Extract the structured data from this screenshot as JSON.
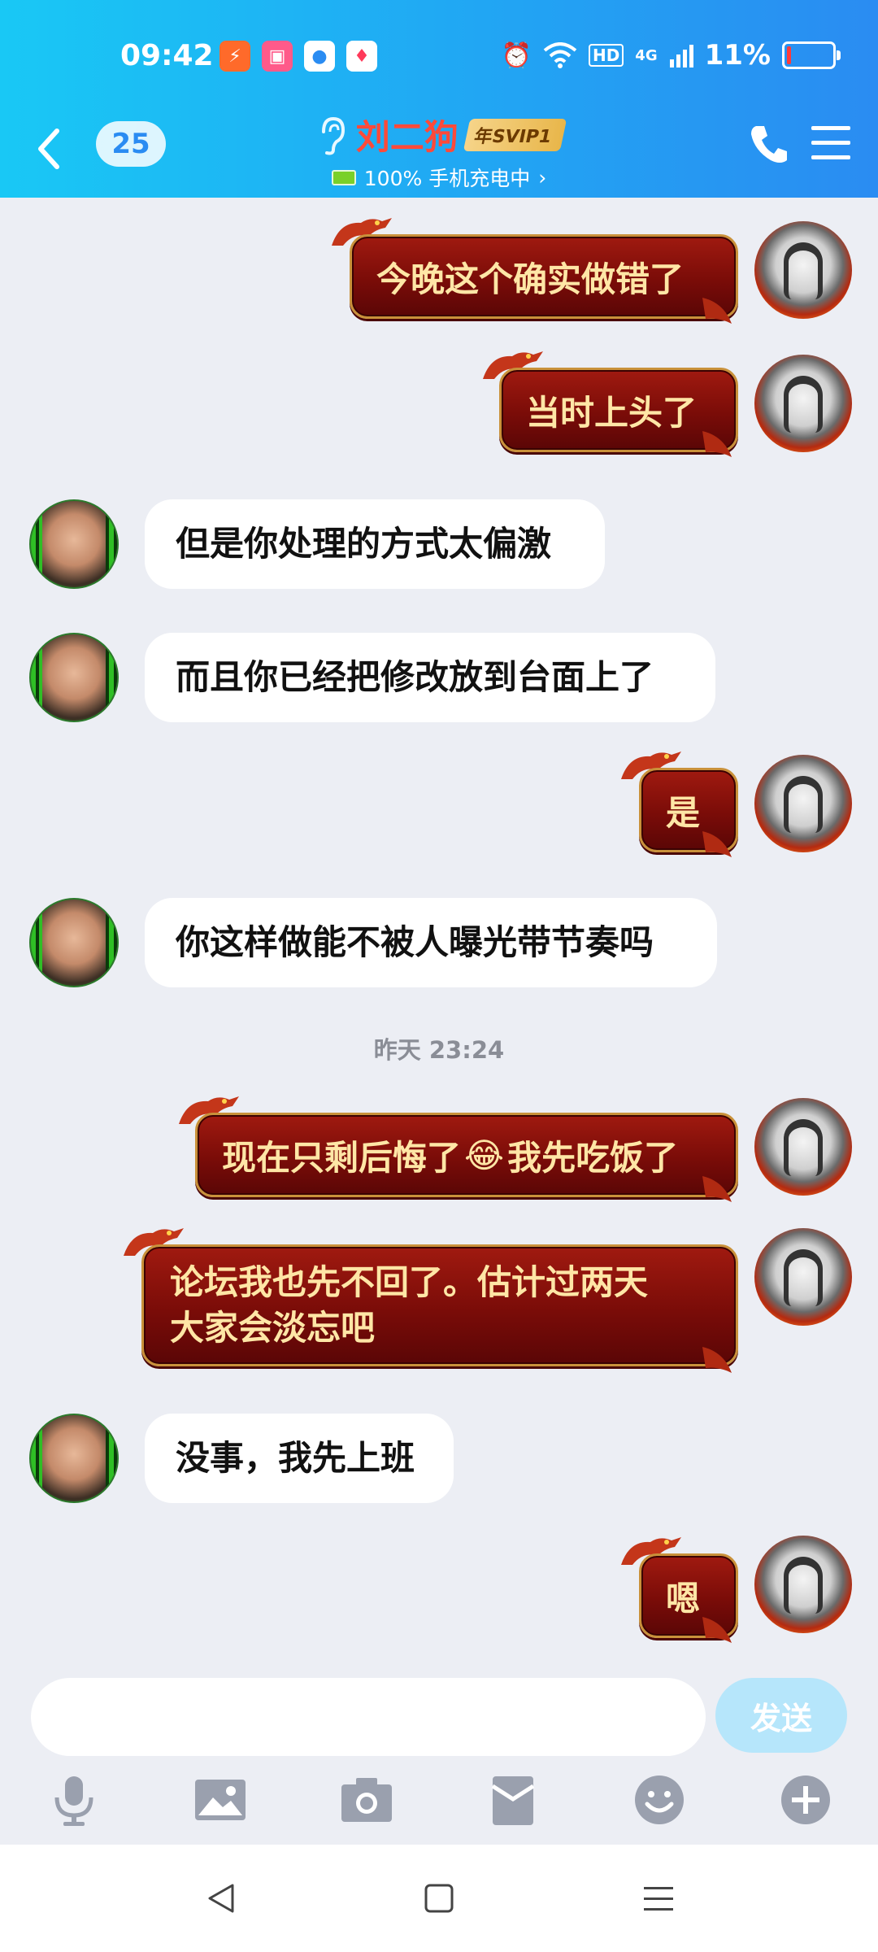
{
  "status_bar": {
    "time": "09:42",
    "battery_percent": "11%",
    "network": "4G",
    "hd": "HD",
    "battery_level": 0.11,
    "icons": [
      "alarm-icon",
      "wifi-icon",
      "hd-icon",
      "signal-icon"
    ]
  },
  "header": {
    "unread_count": "25",
    "contact_name": "刘二狗",
    "svip_badge": "年SVIP1",
    "device_status": "100% 手机充电中",
    "chevron": "›",
    "colors": {
      "gradient_start": "#19c8f5",
      "gradient_end": "#2a8cf2",
      "name": "#ff4a3a"
    }
  },
  "messages": [
    {
      "side": "right",
      "text": "今晚这个确实做错了"
    },
    {
      "side": "right",
      "text": "当时上头了"
    },
    {
      "side": "left",
      "text": "但是你处理的方式太偏激"
    },
    {
      "side": "left",
      "text": "而且你已经把修改放到台面上了"
    },
    {
      "side": "right",
      "text": "是"
    },
    {
      "side": "left",
      "text": "你这样做能不被人曝光带节奏吗"
    },
    {
      "side": "right",
      "text": "现在只剩后悔了",
      "emoji": "😂",
      "text_after": "我先吃饭了"
    },
    {
      "side": "right",
      "line1": "论坛我也先不回了。估计过两天",
      "line2": "大家会淡忘吧"
    },
    {
      "side": "left",
      "text": "没事，我先上班"
    },
    {
      "side": "right",
      "text": "嗯"
    }
  ],
  "timestamp": "昨天 23:24",
  "input": {
    "placeholder": "",
    "send_label": "发送"
  },
  "toolbar": [
    "microphone-icon",
    "image-icon",
    "camera-icon",
    "red-packet-icon",
    "emoji-icon",
    "plus-icon"
  ],
  "system_nav": [
    "back-triangle-icon",
    "home-square-icon",
    "recents-menu-icon"
  ]
}
